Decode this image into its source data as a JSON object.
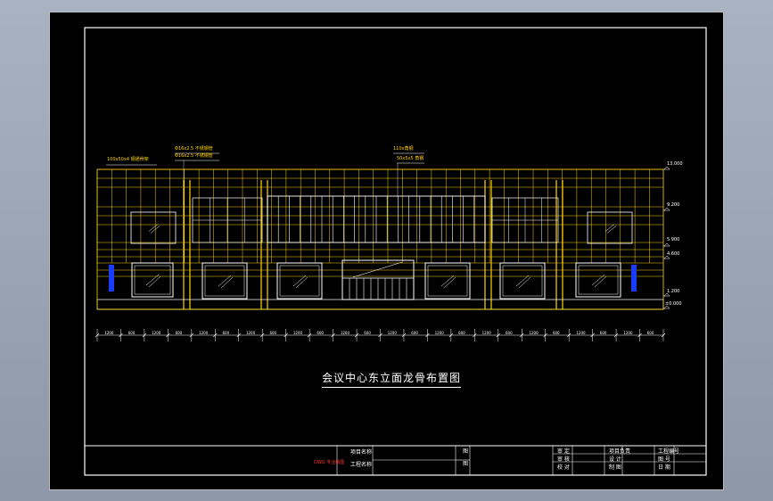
{
  "drawing": {
    "title": "会议中心东立面龙骨布置图",
    "annotations": [
      "100x50x4 钢通骨架",
      "Φ16x2.5 不锈钢管",
      "Φ16x2.5 不锈钢管",
      "110x角钢",
      "50x5x5 角钢"
    ],
    "elevations": [
      "13.000",
      "9.200",
      "5.900",
      "4.600",
      "1.200",
      "±0.000"
    ],
    "dimensions": [
      "1200",
      "600",
      "1200",
      "600",
      "1200",
      "600",
      "1200",
      "600",
      "1200",
      "600",
      "1200",
      "600",
      "1200",
      "600",
      "1200",
      "600",
      "1200",
      "600",
      "1200",
      "600",
      "1200",
      "600",
      "1200",
      "600"
    ]
  },
  "title_block": {
    "col1": [
      "项目名称",
      "工程名称"
    ],
    "stamp": "DWG 专业绘图",
    "col2": [
      "图",
      "图"
    ],
    "col3": [
      "审 定",
      "审 核",
      "校 对"
    ],
    "col4": [
      "项目负责",
      "设 计",
      "制 图"
    ],
    "col5": [
      "工程编号",
      "图 号",
      "日 期"
    ]
  },
  "colors": {
    "background": "#000000",
    "frame": "#ffffff",
    "structure": "#ffd400",
    "outline": "#ffffff",
    "accent": "#ff3030"
  }
}
